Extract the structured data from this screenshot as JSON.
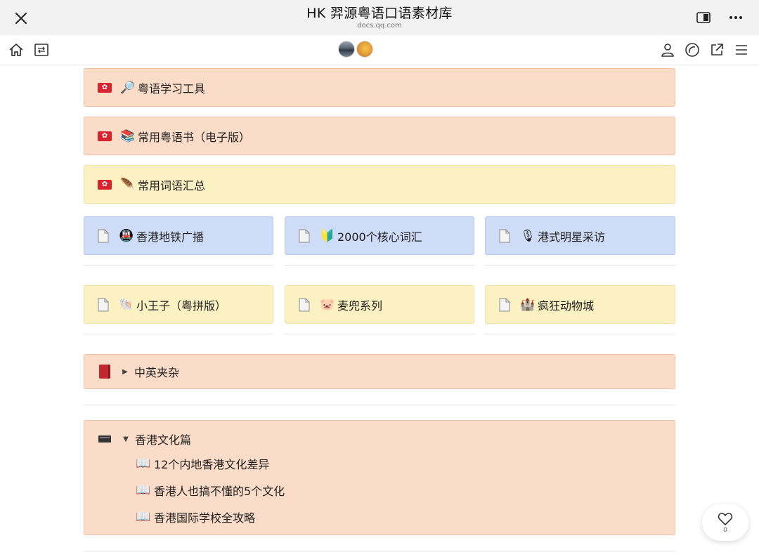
{
  "header": {
    "title": "HK 羿源粤语口语素材库",
    "url": "docs.qq.com"
  },
  "icons": {
    "close": "close-icon",
    "split": "split-view-icon",
    "more": "more-icon",
    "home": "home-icon",
    "outline": "outline-icon",
    "user": "user-icon",
    "comment": "comment-icon",
    "share": "share-icon",
    "menu": "menu-icon"
  },
  "blocks": {
    "tools": {
      "label": "粤语学习工具",
      "emoji": "🔎"
    },
    "books": {
      "label": "常用粤语书（电子版）",
      "emoji": "📚"
    },
    "words": {
      "label": "常用词语汇总",
      "emoji": "🪶"
    }
  },
  "cards": [
    {
      "label": "香港地铁广播",
      "emoji": "🚇"
    },
    {
      "label": "2000个核心词汇",
      "emoji": "🔰"
    },
    {
      "label": "港式明星采访",
      "emoji": "🎙"
    },
    {
      "label": "小王子（粤拼版）",
      "emoji": "🐚"
    },
    {
      "label": "麦兜系列",
      "emoji": "🐷"
    },
    {
      "label": "疯狂动物城",
      "emoji": "🏰"
    }
  ],
  "mixed": {
    "label": "中英夹杂"
  },
  "culture": {
    "label": "香港文化篇",
    "items": [
      "12个内地香港文化差异",
      "香港人也搞不懂的5个文化",
      "香港国际学校全攻略"
    ]
  },
  "like": {
    "count": "0"
  },
  "colors": {
    "peach": "#fbdcc8",
    "yellow": "#fcf1c2",
    "blue": "#cfdcf7",
    "flag_red": "#d9232e"
  }
}
